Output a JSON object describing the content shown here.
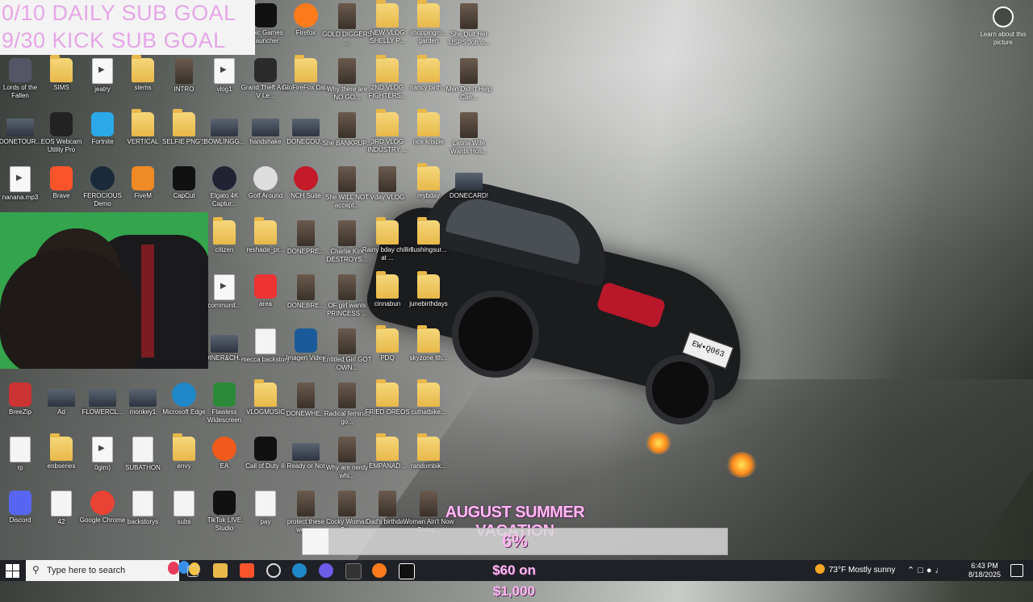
{
  "overlay": {
    "daily_goal": "0/10 DAILY SUB GOAL",
    "kick_goal": "9/30 KICK SUB GOAL"
  },
  "wallpaper": {
    "plate": "EW•Q063"
  },
  "learn_picture": {
    "label": "Learn about this picture"
  },
  "icons": [
    {
      "label": "Lords of the Fallen"
    },
    {
      "label": "SIMS"
    },
    {
      "label": "jeatry"
    },
    {
      "label": "stems"
    },
    {
      "label": "INTRO"
    },
    {
      "label": "vlog1"
    },
    {
      "label": "Epic Games Launcher"
    },
    {
      "label": "Firefox"
    },
    {
      "label": "GOLD DIGGERS ..."
    },
    {
      "label": "NEW VLOG SHELLY P..."
    },
    {
      "label": "shoppingm... garden"
    },
    {
      "label": "She Quit Her USPS Job o..."
    },
    {
      "label": "Grand Theft Auto V Le..."
    },
    {
      "label": "GloFireFox Data"
    },
    {
      "label": "Why there are NO GO..."
    },
    {
      "label": "2ND VLOG FIGHTERS..."
    },
    {
      "label": "nancy birth..."
    },
    {
      "label": "Men Didn't Help Carr..."
    },
    {
      "label": "DONETOUR..."
    },
    {
      "label": "EOS Webcam Utility Pro"
    },
    {
      "label": "Fortnite"
    },
    {
      "label": "VERTICAL"
    },
    {
      "label": "SELFIE PNG'S"
    },
    {
      "label": "BOWLINGG..."
    },
    {
      "label": "handshake"
    },
    {
      "label": "DONECOU..."
    },
    {
      "label": "She BANKRUP..."
    },
    {
      "label": "3RD VLOG INDUSTRY ..."
    },
    {
      "label": "rice krispie"
    },
    {
      "label": "Latina Wife Wants Hus..."
    },
    {
      "label": "nanana.mp3"
    },
    {
      "label": "Brave"
    },
    {
      "label": "FEROCIOUS Demo"
    },
    {
      "label": "FiveM"
    },
    {
      "label": "CapCut"
    },
    {
      "label": "Elgato 4K Captur..."
    },
    {
      "label": "Golf Around"
    },
    {
      "label": "NCH Suite"
    },
    {
      "label": "She WILL NOT accept..."
    },
    {
      "label": "Vday VLOG"
    },
    {
      "label": "mybday"
    },
    {
      "label": "DONECARD!"
    },
    {
      "label": "citizen"
    },
    {
      "label": "reshade_pr..."
    },
    {
      "label": "DONEPRE..."
    },
    {
      "label": "Charlie Kirk DESTROYS..."
    },
    {
      "label": "Rainy bday chillin at ..."
    },
    {
      "label": "flushingsur..."
    },
    {
      "label": "communit..."
    },
    {
      "label": "area"
    },
    {
      "label": "DONEBRE..."
    },
    {
      "label": "OF girl wants PRINCESS ..."
    },
    {
      "label": "cinnabun"
    },
    {
      "label": "junebirthdays"
    },
    {
      "label": "experience"
    },
    {
      "label": "DINER&CH..."
    },
    {
      "label": "mecca backstory"
    },
    {
      "label": "Imagen Video"
    },
    {
      "label": "Entitled Girl GOT OWN..."
    },
    {
      "label": "PDQ"
    },
    {
      "label": "skyzone lth..."
    },
    {
      "label": "BreeZip"
    },
    {
      "label": "Ad"
    },
    {
      "label": "FLOWERCL..."
    },
    {
      "label": "monkey1"
    },
    {
      "label": "Microsoft Edge"
    },
    {
      "label": "Flawless Widescreen"
    },
    {
      "label": "VLOGMUSIC"
    },
    {
      "label": "DONEWHE..."
    },
    {
      "label": "Radical feminist go..."
    },
    {
      "label": "FRIED OREOS"
    },
    {
      "label": "cuthatbike..."
    },
    {
      "label": "rp"
    },
    {
      "label": "enbseries"
    },
    {
      "label": "0gim)"
    },
    {
      "label": "SUBATHON"
    },
    {
      "label": "envy"
    },
    {
      "label": "EA"
    },
    {
      "label": "Call of Duty ®"
    },
    {
      "label": "Ready or Not"
    },
    {
      "label": "Why are nerdy whi..."
    },
    {
      "label": "EMPANAD..."
    },
    {
      "label": "randombik..."
    },
    {
      "label": "Discord"
    },
    {
      "label": "42"
    },
    {
      "label": "Google Chrome"
    },
    {
      "label": "backstorys"
    },
    {
      "label": "subs"
    },
    {
      "label": "TikTok LIVE Studio"
    },
    {
      "label": "pay"
    },
    {
      "label": "protect these wom..."
    },
    {
      "label": "Cocky Woman Ge..."
    },
    {
      "label": "Dad's birthda..."
    },
    {
      "label": "Woman Ain't Now Giving..."
    }
  ],
  "vacation": {
    "title": "AUGUST SUMMER VACATION",
    "percent_label": "6%",
    "progress": 0.06,
    "amount": "$60 on $1,000"
  },
  "taskbar": {
    "search_placeholder": "Type here to search",
    "weather": "73°F  Mostly sunny",
    "time": "6:43 PM",
    "date": "8/18/2025"
  }
}
